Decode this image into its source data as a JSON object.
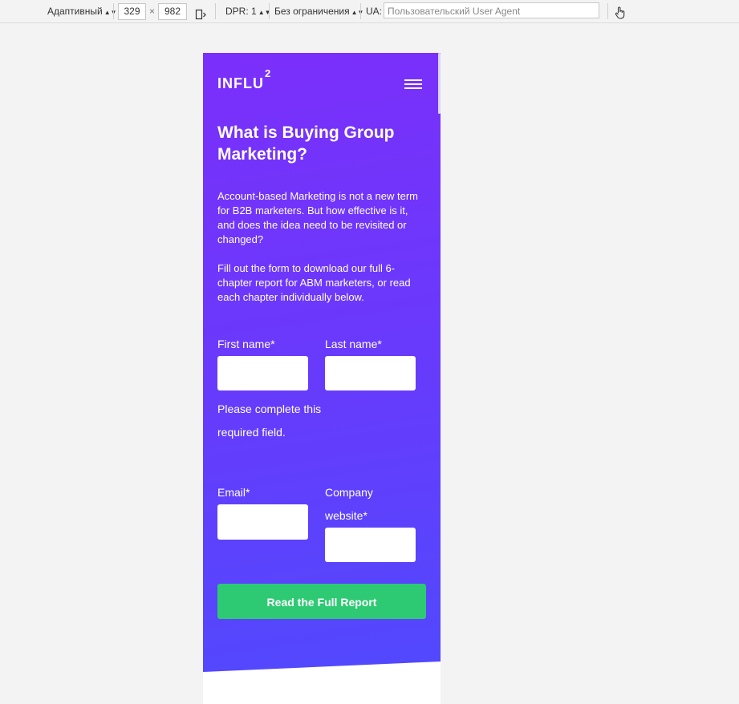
{
  "toolbar": {
    "device_mode": "Адаптивный",
    "width": "329",
    "times": "×",
    "height": "982",
    "dpr": "DPR: 1",
    "throttling": "Без ограничения",
    "ua_label": "UA:",
    "ua_placeholder": "Пользовательский User Agent"
  },
  "site": {
    "logo": "INFLU",
    "logo_sup": "2"
  },
  "hero": {
    "title": "What is Buying Group Marketing?",
    "paragraph1": "Account-based Marketing is not a new term for B2B marketers. But how effective is it, and does the idea need to be revisited or changed?",
    "paragraph2": "Fill out the form to download our full 6-chapter report for ABM marketers, or read each chapter individually below."
  },
  "form": {
    "first_name_label": "First name*",
    "last_name_label": "Last name*",
    "error_message": "Please complete this required field.",
    "email_label": "Email*",
    "company_website_label": "Company website*",
    "submit_label": "Read the Full Report"
  },
  "colors": {
    "gradient_top": "#7b2ffa",
    "gradient_bottom": "#5149fd",
    "cta": "#2dca73"
  }
}
